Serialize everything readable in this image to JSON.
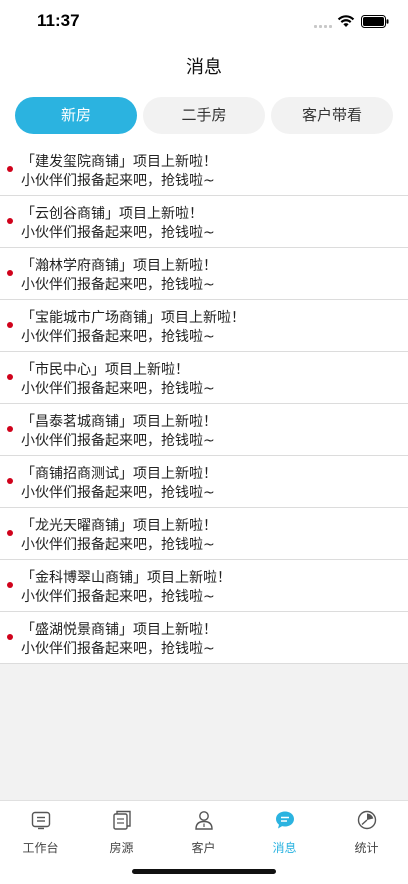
{
  "status_bar": {
    "time": "11:37"
  },
  "header": {
    "title": "消息"
  },
  "tabs": [
    {
      "label": "新房",
      "active": true
    },
    {
      "label": "二手房",
      "active": false
    },
    {
      "label": "客户带看",
      "active": false
    }
  ],
  "messages": [
    {
      "title": "「建发玺院商铺」项目上新啦！",
      "body": "小伙伴们报备起来吧，抢钱啦~",
      "unread": true
    },
    {
      "title": "「云创谷商铺」项目上新啦！",
      "body": "小伙伴们报备起来吧，抢钱啦~",
      "unread": true
    },
    {
      "title": "「瀚林学府商铺」项目上新啦！",
      "body": "小伙伴们报备起来吧，抢钱啦~",
      "unread": true
    },
    {
      "title": "「宝能城市广场商铺」项目上新啦！",
      "body": "小伙伴们报备起来吧，抢钱啦~",
      "unread": true
    },
    {
      "title": "「市民中心」项目上新啦！",
      "body": "小伙伴们报备起来吧，抢钱啦~",
      "unread": true
    },
    {
      "title": "「昌泰茗城商铺」项目上新啦！",
      "body": "小伙伴们报备起来吧，抢钱啦~",
      "unread": true
    },
    {
      "title": "「商铺招商测试」项目上新啦！",
      "body": "小伙伴们报备起来吧，抢钱啦~",
      "unread": true
    },
    {
      "title": "「龙光天曜商铺」项目上新啦！",
      "body": "小伙伴们报备起来吧，抢钱啦~",
      "unread": true
    },
    {
      "title": "「金科博翠山商铺」项目上新啦！",
      "body": "小伙伴们报备起来吧，抢钱啦~",
      "unread": true
    },
    {
      "title": "「盛湖悦景商铺」项目上新啦！",
      "body": "小伙伴们报备起来吧，抢钱啦~",
      "unread": true
    }
  ],
  "tabbar": [
    {
      "label": "工作台",
      "icon": "workbench-icon",
      "active": false
    },
    {
      "label": "房源",
      "icon": "listings-icon",
      "active": false
    },
    {
      "label": "客户",
      "icon": "customer-icon",
      "active": false
    },
    {
      "label": "消息",
      "icon": "message-icon",
      "active": true
    },
    {
      "label": "统计",
      "icon": "statistics-icon",
      "active": false
    }
  ],
  "colors": {
    "accent": "#2bb3e0",
    "unread_dot": "#d0021b",
    "background": "#f2f2f2"
  }
}
